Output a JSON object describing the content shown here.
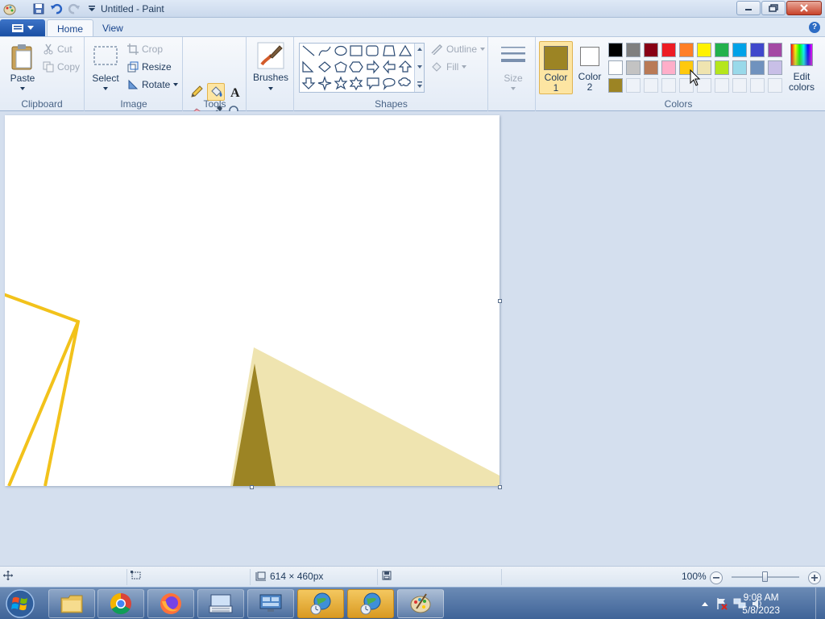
{
  "window": {
    "title": "Untitled - Paint"
  },
  "tabs": {
    "home": "Home",
    "view": "View"
  },
  "clipboard": {
    "paste": "Paste",
    "cut": "Cut",
    "copy": "Copy",
    "group": "Clipboard"
  },
  "image": {
    "select": "Select",
    "crop": "Crop",
    "resize": "Resize",
    "rotate": "Rotate",
    "group": "Image"
  },
  "tools": {
    "group": "Tools"
  },
  "brushes": {
    "label": "Brushes"
  },
  "shapes": {
    "outline": "Outline",
    "fill": "Fill",
    "group": "Shapes"
  },
  "size": {
    "label": "Size"
  },
  "colors": {
    "color1_line1": "Color",
    "color1_line2": "1",
    "color2_line1": "Color",
    "color2_line2": "2",
    "edit_line1": "Edit",
    "edit_line2": "colors",
    "group": "Colors",
    "color1_value": "#9c8424",
    "color2_value": "#ffffff",
    "palette": [
      "#000000",
      "#7f7f7f",
      "#880015",
      "#ed1c24",
      "#ff7f27",
      "#fff200",
      "#22b14c",
      "#00a2e8",
      "#3f48cc",
      "#a349a4",
      "#ffffff",
      "#c3c3c3",
      "#b97a57",
      "#ffaec9",
      "#ffc90e",
      "#efe4b0",
      "#b5e61d",
      "#99d9ea",
      "#7092be",
      "#c8bfe7",
      "#9c8424",
      "",
      "",
      "",
      "",
      "",
      "",
      "",
      "",
      ""
    ]
  },
  "statusbar": {
    "dimensions": "614 × 460px",
    "zoom": "100%"
  },
  "taskbar": {
    "time": "9:08 AM",
    "date": "5/8/2023"
  }
}
